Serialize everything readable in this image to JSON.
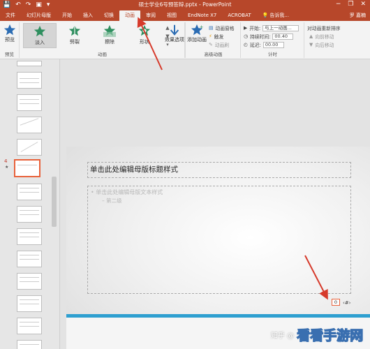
{
  "window": {
    "title": "硕士学业6号预答辩.pptx - PowerPoint",
    "user": "罗 嘉楠",
    "controls": [
      "−",
      "❐",
      "✕"
    ]
  },
  "qat": [
    "💾",
    "↶",
    "↷",
    "▣",
    "▾"
  ],
  "tabs": [
    {
      "label": "文件",
      "active": false
    },
    {
      "label": "幻灯片母版",
      "active": false
    },
    {
      "label": "开始",
      "active": false
    },
    {
      "label": "插入",
      "active": false
    },
    {
      "label": "切换",
      "active": false
    },
    {
      "label": "动画",
      "active": true
    },
    {
      "label": "审阅",
      "active": false
    },
    {
      "label": "视图",
      "active": false
    },
    {
      "label": "EndNote X7",
      "active": false
    },
    {
      "label": "ACROBAT",
      "active": false
    }
  ],
  "tell_me": "告诉我...",
  "ribbon": {
    "preview": {
      "label": "预览",
      "group": "预览"
    },
    "animations": {
      "group": "动画",
      "items": [
        {
          "label": "淡入",
          "selected": true,
          "color": "#2f8f5f"
        },
        {
          "label": "劈裂",
          "selected": false,
          "color": "#2f8f5f"
        },
        {
          "label": "擦除",
          "selected": false,
          "color": "#2f8f5f"
        },
        {
          "label": "形状",
          "selected": false,
          "color": "#2f8f5f"
        }
      ]
    },
    "effect_options": {
      "label": "效果选项"
    },
    "advanced": {
      "group": "高级动画",
      "add_animation": "添加动画",
      "pane": "动画窗格",
      "trigger": "触发",
      "painter": "动画刷"
    },
    "timing": {
      "group": "计时",
      "start_label": "开始:",
      "start_value": "与上一动画...",
      "duration_label": "持续时间:",
      "duration_value": "00.40",
      "delay_label": "延迟:",
      "delay_value": "00.00"
    },
    "reorder": {
      "title": "对动画重新排序",
      "earlier": "向前移动",
      "later": "向后移动"
    }
  },
  "thumbnails": {
    "selected_number": "4",
    "star": "★"
  },
  "slide": {
    "title_placeholder": "单击此处编辑母版标题样式",
    "body_level1": "单击此处编辑母版文本样式",
    "body_level2": "第二级",
    "page_number": "0",
    "number_glyph": "‹#›"
  },
  "watermark": {
    "source": "知乎 @",
    "logo": "看看手游网"
  },
  "colors": {
    "accent": "#b7472a",
    "selection": "#e8613a",
    "footer_bar": "#2e9fd0",
    "annotation": "#d63a2b"
  }
}
